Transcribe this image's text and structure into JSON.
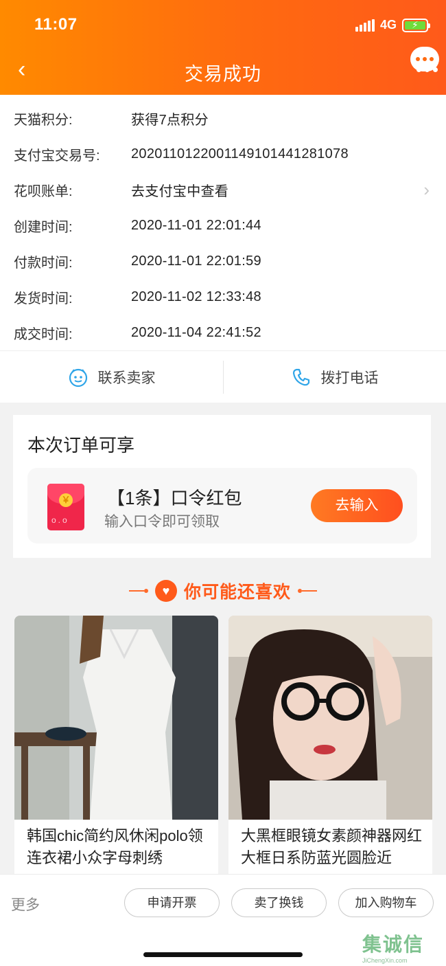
{
  "status_bar": {
    "time": "11:07",
    "network": "4G"
  },
  "header": {
    "title": "交易成功"
  },
  "info_rows": [
    {
      "key": "天猫积分:",
      "value": "获得7点积分"
    },
    {
      "key": "支付宝交易号:",
      "value": "20201101220011491014412810​78"
    },
    {
      "key": "花呗账单:",
      "value": "去支付宝中查看",
      "chevron": true
    },
    {
      "key": "创建时间:",
      "value": "2020-11-01 22:01:44"
    },
    {
      "key": "付款时间:",
      "value": "2020-11-01 22:01:59"
    },
    {
      "key": "发货时间:",
      "value": "2020-11-02 12:33:48"
    },
    {
      "key": "成交时间:",
      "value": "2020-11-04 22:41:52"
    }
  ],
  "actions": {
    "contact_seller": "联系卖家",
    "call_phone": "拨打电话"
  },
  "benefit": {
    "title": "本次订单可享",
    "coupon_title": "【1条】口令红包",
    "coupon_sub": "输入口令即可领取",
    "coupon_button": "去输入",
    "redpack_symbol": "￥",
    "redpack_face": "o.o"
  },
  "recommend": {
    "heading": "你可能还喜欢",
    "products": [
      {
        "name": "韩国chic简约风休闲polo领连衣裙小众字母刺绣"
      },
      {
        "name": "大黑框眼镜女素颜神器网红大框日系防蓝光圆脸近"
      }
    ]
  },
  "bottom_bar": {
    "more": "更多",
    "invoice": "申请开票",
    "resell": "卖了换钱",
    "add_cart": "加入购物车"
  },
  "watermark": {
    "cjk": "集诚信",
    "url": "JiChengXin.com"
  },
  "colors": {
    "brand_orange": "#ff6a10",
    "accent_red": "#ff5a1a"
  }
}
